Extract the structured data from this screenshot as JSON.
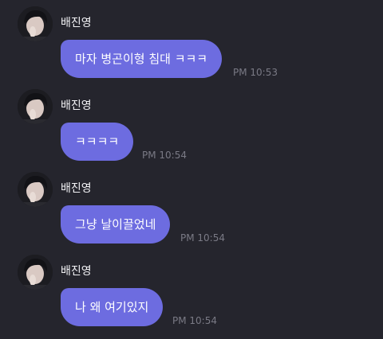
{
  "chat": {
    "messages": [
      {
        "sender": "배진영",
        "text": "마자 병곤이형 침대 ㅋㅋㅋ",
        "time": "PM 10:53",
        "avatar_icon": "profile-photo"
      },
      {
        "sender": "배진영",
        "text": "ㅋㅋㅋㅋ",
        "time": "PM 10:54",
        "avatar_icon": "profile-photo"
      },
      {
        "sender": "배진영",
        "text": "그냥 날이끌었네",
        "time": "PM 10:54",
        "avatar_icon": "profile-photo"
      },
      {
        "sender": "배진영",
        "text": "나 왜 여기있지",
        "time": "PM 10:54",
        "avatar_icon": "profile-photo"
      }
    ]
  },
  "colors": {
    "background": "#25252d",
    "bubble": "#6d6ce0",
    "bubble_text": "#ffffff",
    "sender_text": "#f2f2f5",
    "timestamp_text": "#7a7a85"
  }
}
